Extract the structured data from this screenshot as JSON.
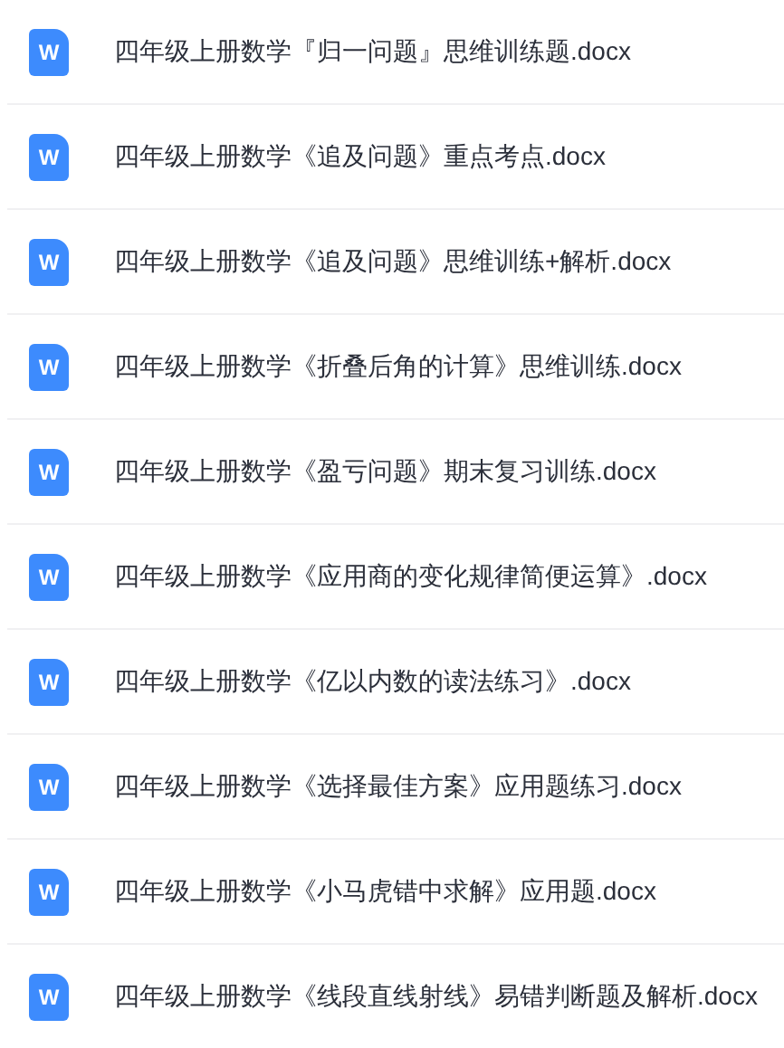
{
  "files": [
    {
      "icon_label": "W",
      "name": "四年级上册数学『归一问题』思维训练题.docx"
    },
    {
      "icon_label": "W",
      "name": "四年级上册数学《追及问题》重点考点.docx"
    },
    {
      "icon_label": "W",
      "name": "四年级上册数学《追及问题》思维训练+解析.docx"
    },
    {
      "icon_label": "W",
      "name": "四年级上册数学《折叠后角的计算》思维训练.docx"
    },
    {
      "icon_label": "W",
      "name": "四年级上册数学《盈亏问题》期末复习训练.docx"
    },
    {
      "icon_label": "W",
      "name": "四年级上册数学《应用商的变化规律简便运算》.docx"
    },
    {
      "icon_label": "W",
      "name": "四年级上册数学《亿以内数的读法练习》.docx"
    },
    {
      "icon_label": "W",
      "name": "四年级上册数学《选择最佳方案》应用题练习.docx"
    },
    {
      "icon_label": "W",
      "name": "四年级上册数学《小马虎错中求解》应用题.docx"
    },
    {
      "icon_label": "W",
      "name": "四年级上册数学《线段直线射线》易错判断题及解析.docx"
    }
  ]
}
